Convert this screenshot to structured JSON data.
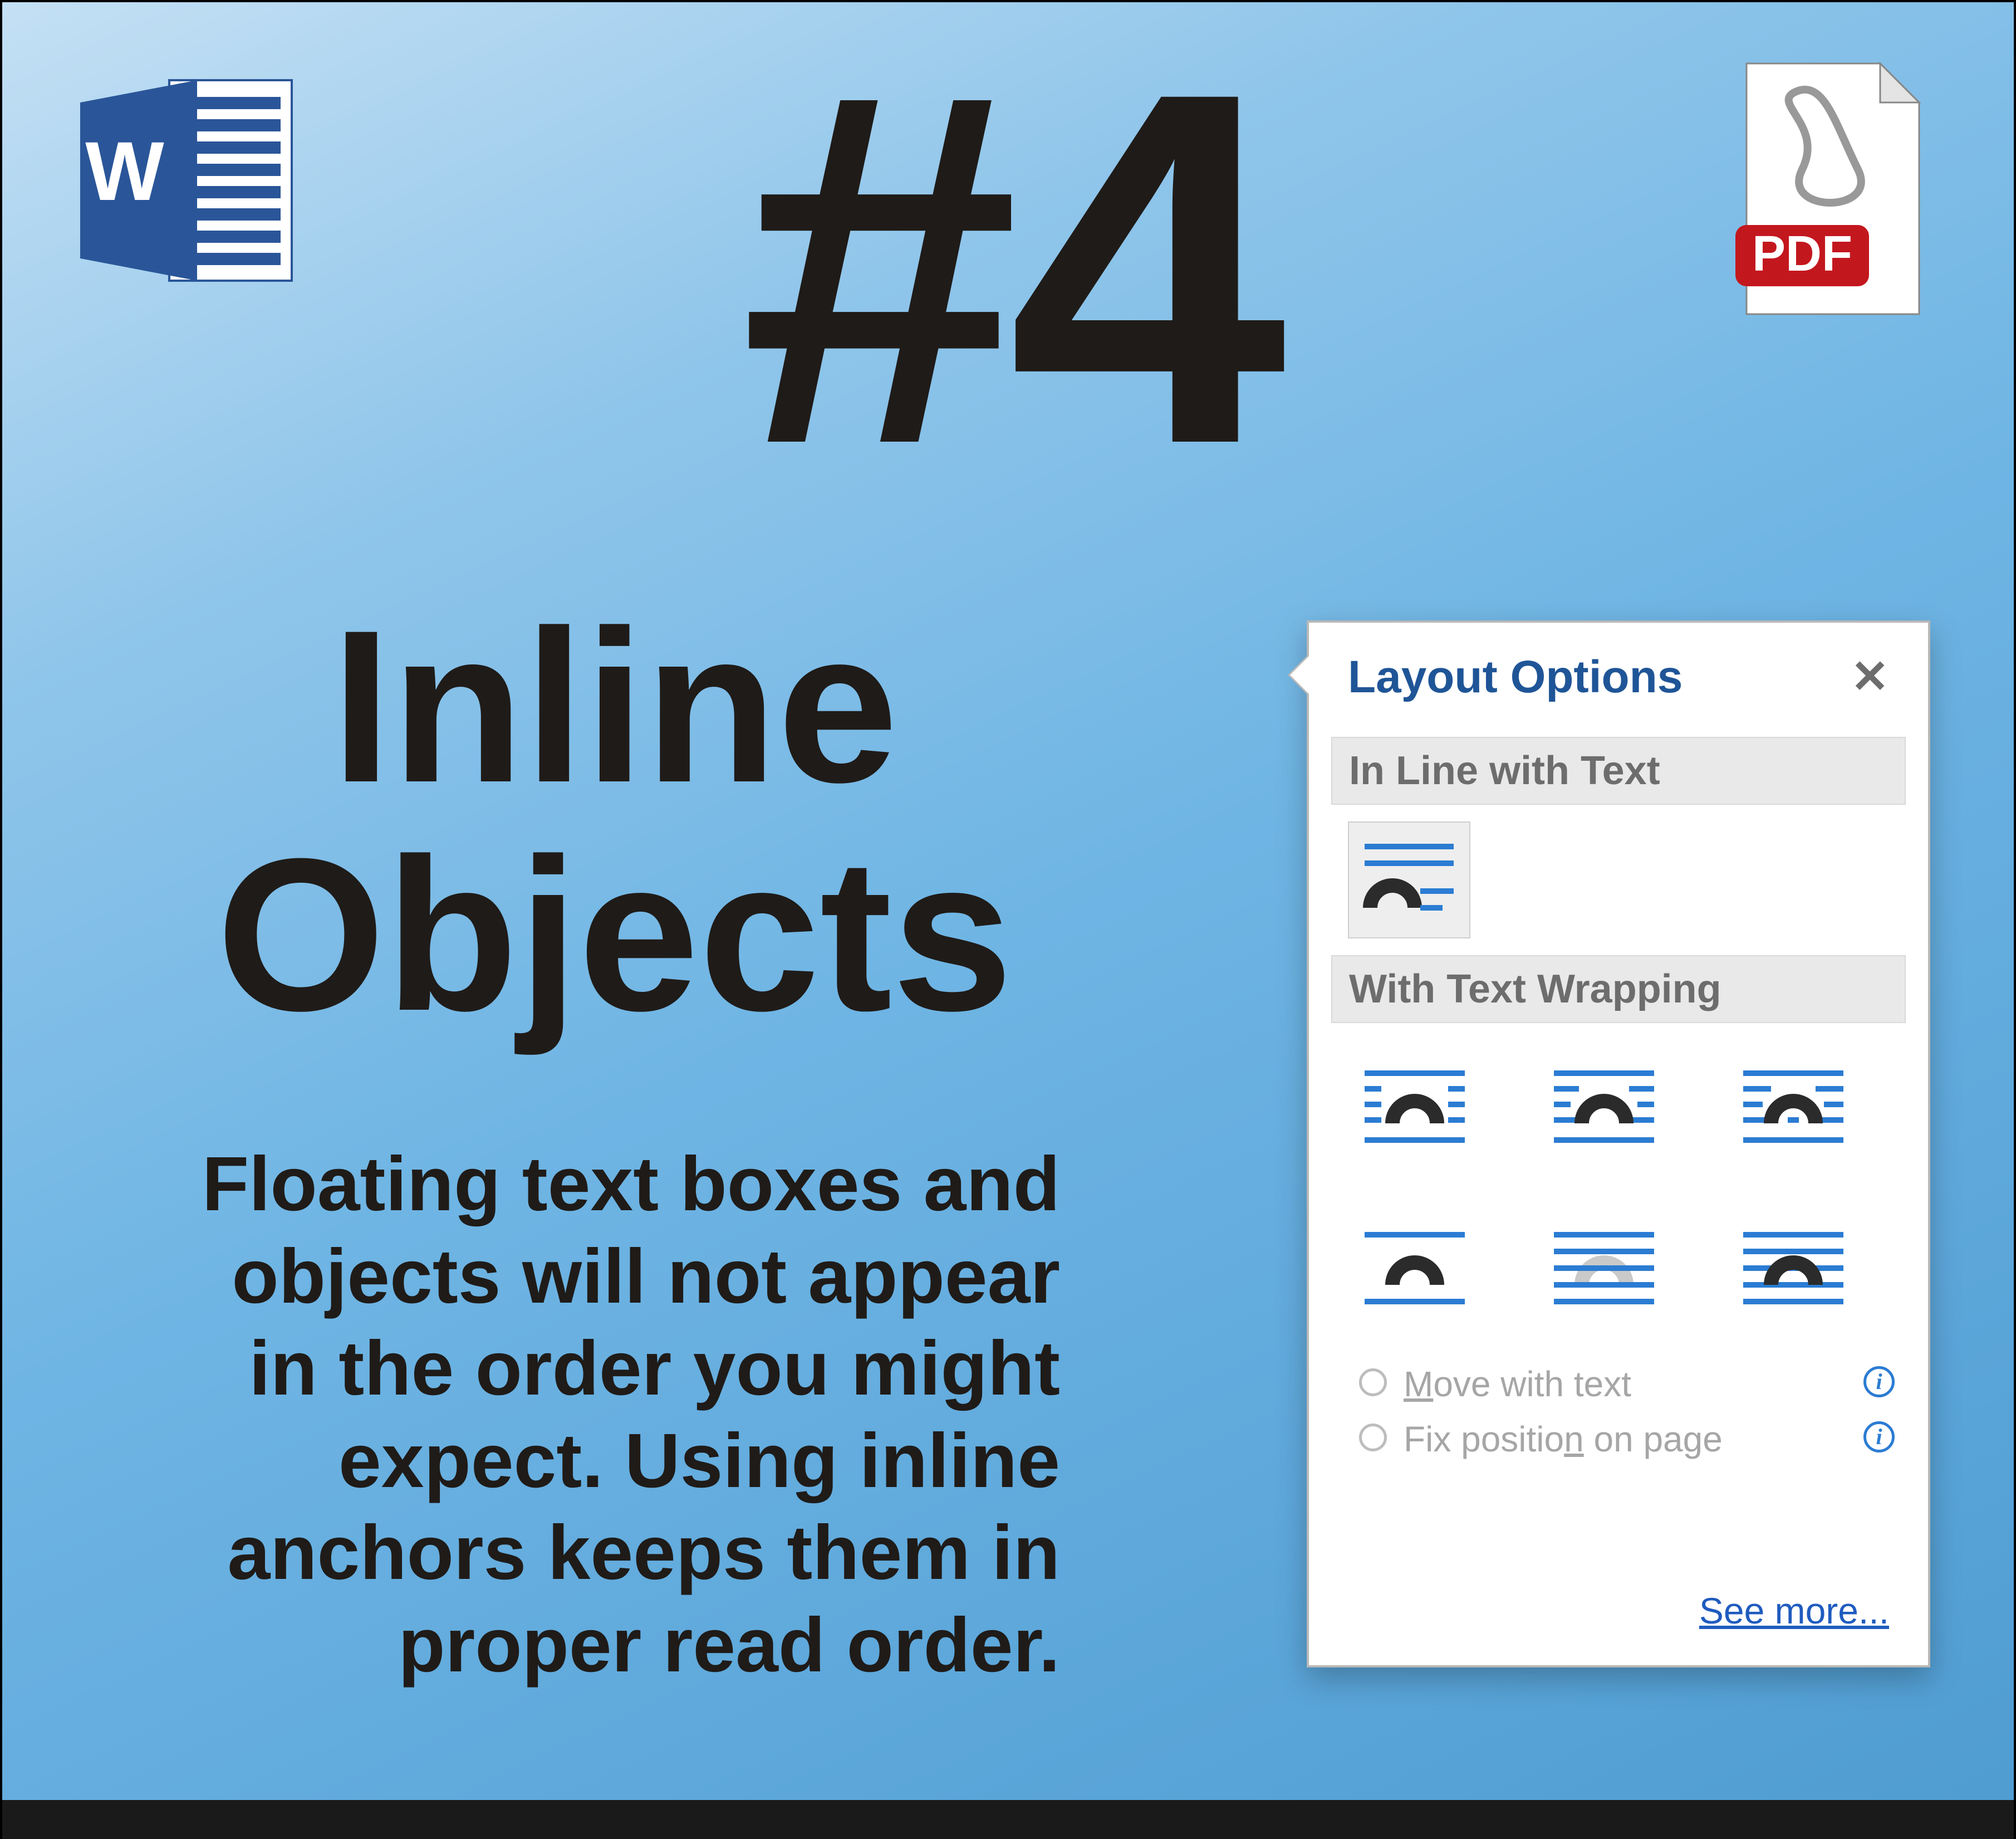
{
  "bignum": "#4",
  "title": "Inline Objects",
  "body": "Floating text boxes and objects will not appear in the order you might expect. Using inline anchors keeps them in proper read order.",
  "icons": {
    "word": "word-icon",
    "pdf": "pdf-icon",
    "pdf_label": "PDF"
  },
  "layout_options": {
    "title": "Layout Options",
    "close": "✕",
    "section_inline": "In Line with Text",
    "section_wrap": "With Text Wrapping",
    "wrap_items": [
      "square",
      "tight",
      "through",
      "top-bottom",
      "behind-text",
      "in-front-of-text"
    ],
    "radio_move": "Move with text",
    "radio_fix": "Fix position on page",
    "see_more": "See more..."
  }
}
